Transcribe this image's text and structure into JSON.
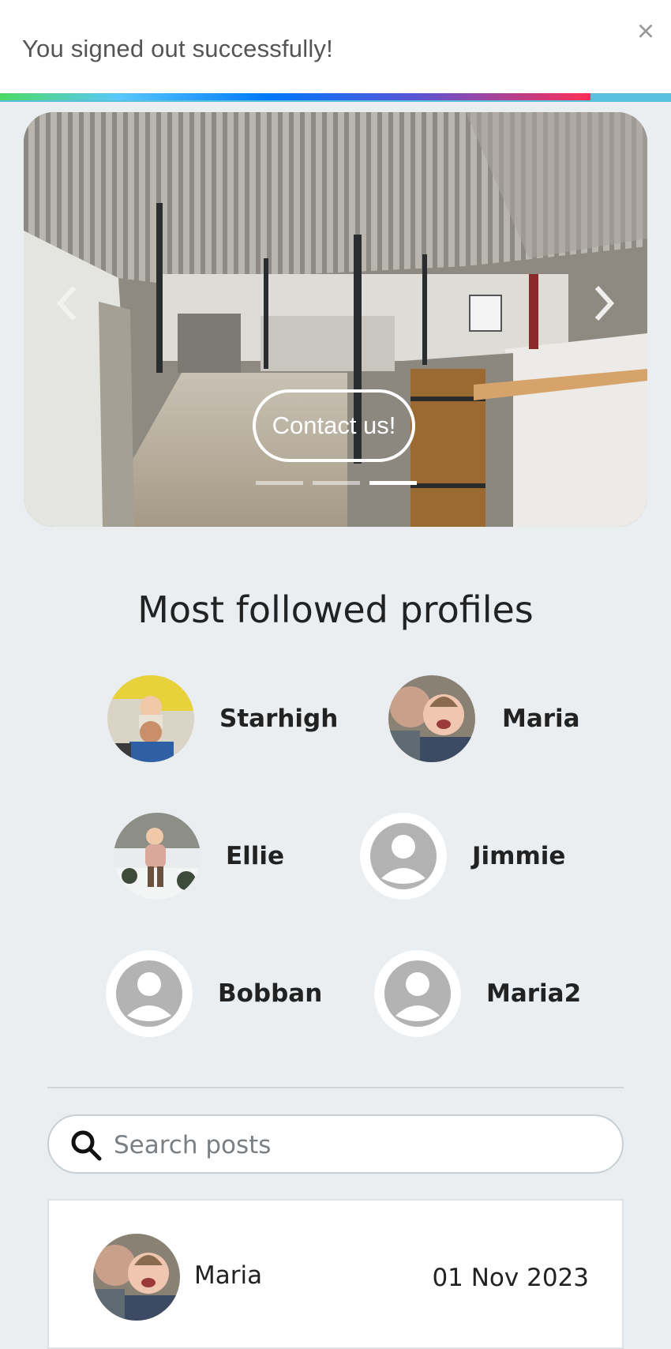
{
  "toast": {
    "message": "You signed out successfully!",
    "close_label": "×",
    "progress_percent": 88
  },
  "carousel": {
    "contact_label": "Contact us!",
    "slide_count": 3,
    "active_slide": 3,
    "prev_icon": "chevron-left-icon",
    "next_icon": "chevron-right-icon"
  },
  "profiles": {
    "title": "Most followed profiles",
    "items": [
      {
        "name": "Starhigh",
        "avatar": "photo-child-on-shoulders"
      },
      {
        "name": "Maria",
        "avatar": "photo-mother-baby"
      },
      {
        "name": "Ellie",
        "avatar": "photo-child-in-snow"
      },
      {
        "name": "Jimmie",
        "avatar": "default-user-icon"
      },
      {
        "name": "Bobban",
        "avatar": "default-user-icon"
      },
      {
        "name": "Maria2",
        "avatar": "default-user-icon"
      }
    ]
  },
  "search": {
    "placeholder": "Search posts",
    "value": "",
    "icon": "search-icon"
  },
  "post": {
    "author": "Maria",
    "date": "01 Nov 2023"
  },
  "colors": {
    "page_bg": "#eaeef0",
    "toast_track": "#5bc0de",
    "text": "#222222"
  }
}
